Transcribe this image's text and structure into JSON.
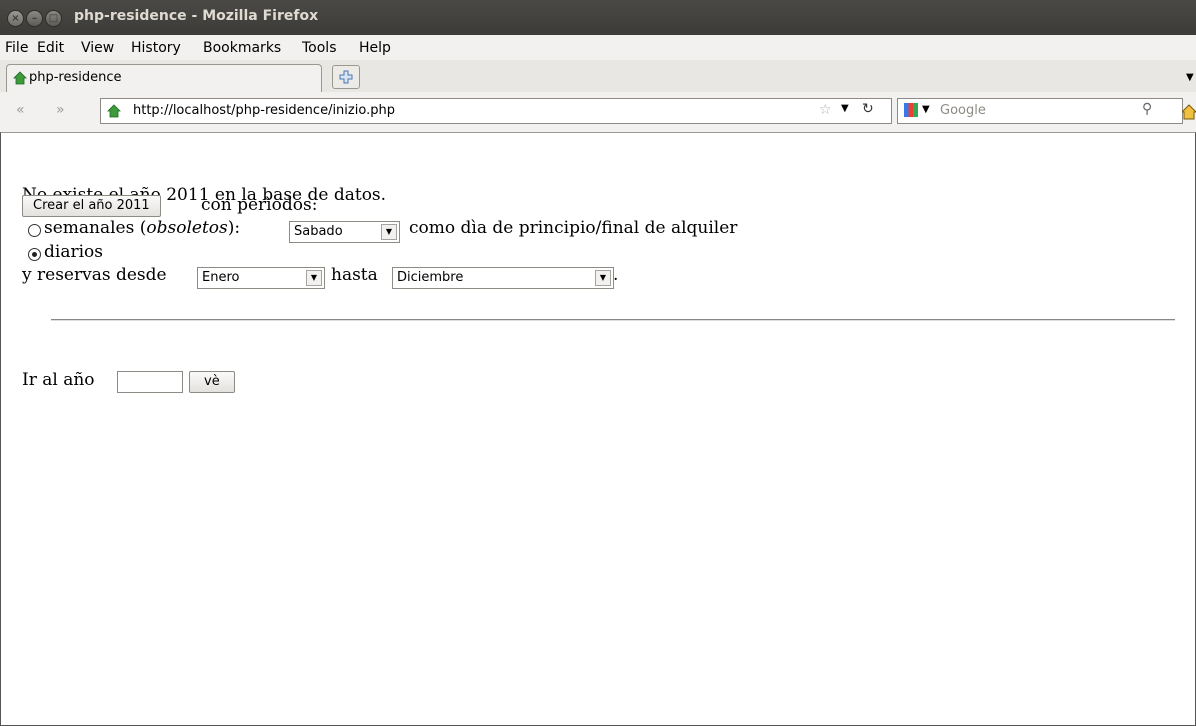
{
  "window": {
    "title": "php-residence - Mozilla Firefox"
  },
  "menu": [
    {
      "label": "File"
    },
    {
      "label": "Edit"
    },
    {
      "label": "View"
    },
    {
      "label": "History"
    },
    {
      "label": "Bookmarks"
    },
    {
      "label": "Tools"
    },
    {
      "label": "Help"
    }
  ],
  "tab": {
    "title": "php-residence"
  },
  "nav": {
    "url": "http://localhost/php-residence/inizio.php",
    "search_placeholder": "Google"
  },
  "page": {
    "message": "No existe el año 2011 en la base de datos.",
    "create_button": "Crear el año 2011",
    "periods_label": "con perìodos:",
    "weekly_label": "semanales (",
    "weekly_em": "obsoletos",
    "weekly_after": "):",
    "weekday_value": "Sabado",
    "weekday_suffix": "como dìa de principio/final de alquiler",
    "daily_label": "diarios",
    "reservations_from": "y reservas desde",
    "from_month": "Enero",
    "to_label": "hasta",
    "to_month": "Diciembre",
    "period_dot": ".",
    "go_label": "Ir al año",
    "go_button": "vè",
    "daily_selected": true
  },
  "colors": {
    "titlebar": "#3c3b37",
    "content_bg": "#ffffff",
    "chrome": "#f2f1f0"
  }
}
